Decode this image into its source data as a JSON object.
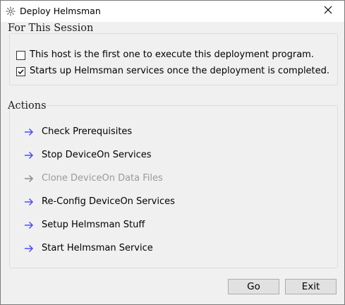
{
  "window": {
    "title": "Deploy Helmsman",
    "icon": "gear-icon",
    "close_icon": "close-icon"
  },
  "session": {
    "legend": "For This Session",
    "options": [
      {
        "label": "This host is the first one to execute this deployment program.",
        "checked": false
      },
      {
        "label": "Starts up Helmsman services once the deployment is completed.",
        "checked": true
      }
    ]
  },
  "actions": {
    "legend": "Actions",
    "items": [
      {
        "label": "Check Prerequisites",
        "enabled": true
      },
      {
        "label": "Stop DeviceOn Services",
        "enabled": true
      },
      {
        "label": "Clone DeviceOn Data Files",
        "enabled": false
      },
      {
        "label": "Re-Config DeviceOn Services",
        "enabled": true
      },
      {
        "label": "Setup Helmsman Stuff",
        "enabled": true
      },
      {
        "label": "Start Helmsman Service",
        "enabled": true
      }
    ]
  },
  "buttons": {
    "go": "Go",
    "exit": "Exit"
  },
  "colors": {
    "arrow_enabled": "#4c4cff",
    "arrow_disabled": "#8a8a8a",
    "label_disabled": "#9a9a9a"
  }
}
